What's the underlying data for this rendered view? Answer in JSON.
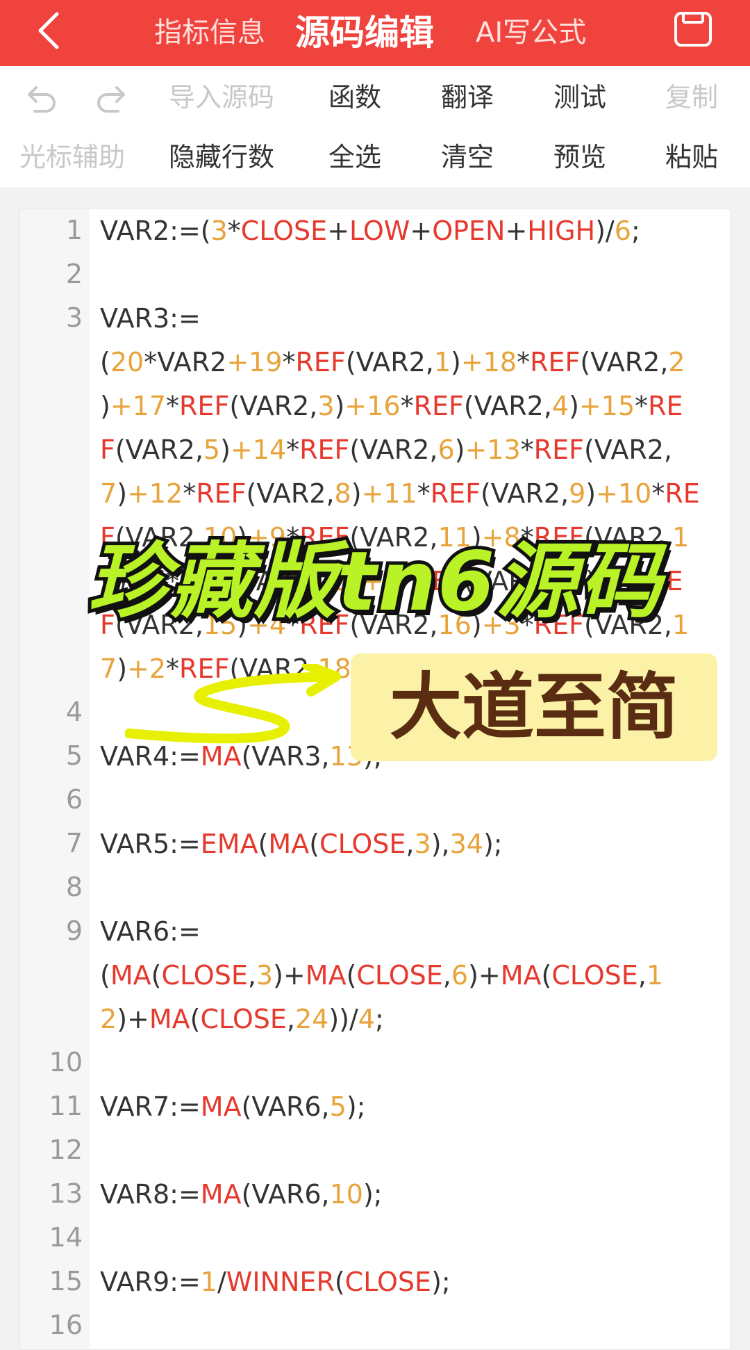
{
  "header": {
    "tabs": [
      {
        "label": "指标信息",
        "active": false
      },
      {
        "label": "源码编辑",
        "active": true
      },
      {
        "label": "AI写公式",
        "active": false
      }
    ],
    "colors": {
      "bar": "#f0433d"
    }
  },
  "toolbar": {
    "row1": [
      "导入源码",
      "函数",
      "翻译",
      "测试",
      "复制"
    ],
    "row2": [
      "光标辅助",
      "隐藏行数",
      "全选",
      "清空",
      "预览",
      "粘贴"
    ]
  },
  "editor": {
    "line_numbers": [
      "1",
      "2",
      "3",
      "4",
      "5",
      "6",
      "7",
      "8",
      "9",
      "10",
      "11",
      "12",
      "13",
      "14",
      "15",
      "16"
    ]
  },
  "overlay": {
    "banner": "珍藏版tn6源码",
    "subtitle": "大道至简"
  },
  "colors": {
    "keyword": "#e6392e",
    "number": "#e8a33a",
    "text": "#333333"
  }
}
